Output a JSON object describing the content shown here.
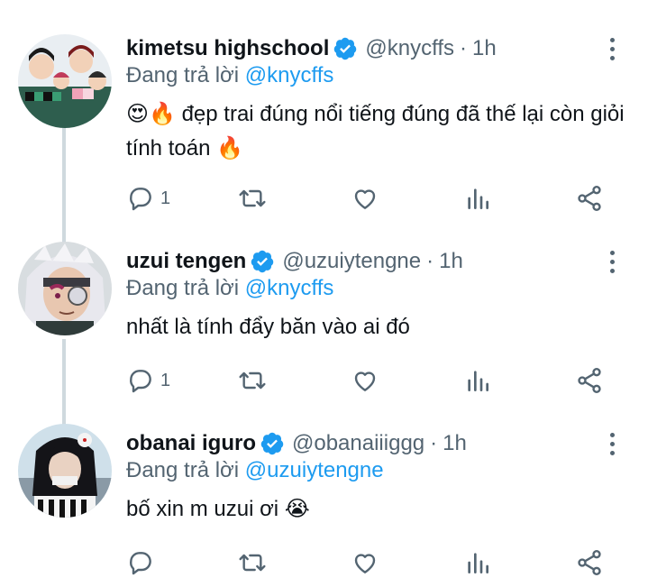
{
  "tweets": [
    {
      "name": "kimetsu highschool",
      "handle": "@knycffs",
      "dot": "·",
      "time": "1h",
      "reply_prefix": "Đang trả lời ",
      "reply_to": "@knycffs",
      "text": "😍🔥 đẹp trai đúng nổi tiếng đúng đã thế lại còn giỏi tính toán 🔥",
      "reply_count": "1"
    },
    {
      "name": "uzui tengen",
      "handle": "@uzuiytengne",
      "dot": "·",
      "time": "1h",
      "reply_prefix": "Đang trả lời ",
      "reply_to": "@knycffs",
      "text": "nhất là tính đẩy băn vào ai đó",
      "reply_count": "1"
    },
    {
      "name": "obanai iguro",
      "handle": "@obanaiiiggg",
      "dot": "·",
      "time": "1h",
      "reply_prefix": "Đang trả lời ",
      "reply_to": "@uzuiytengne",
      "text": "bố xin m uzui ơi 😭",
      "reply_count": ""
    }
  ],
  "colors": {
    "accent": "#1d9bf0",
    "secondary_text": "#536471",
    "thread_line": "#cfd9de",
    "verified": "#1d9bf0"
  },
  "icons": [
    "verified-badge-icon",
    "more-vertical-icon",
    "reply-icon",
    "retweet-icon",
    "like-icon",
    "views-icon",
    "share-icon"
  ]
}
